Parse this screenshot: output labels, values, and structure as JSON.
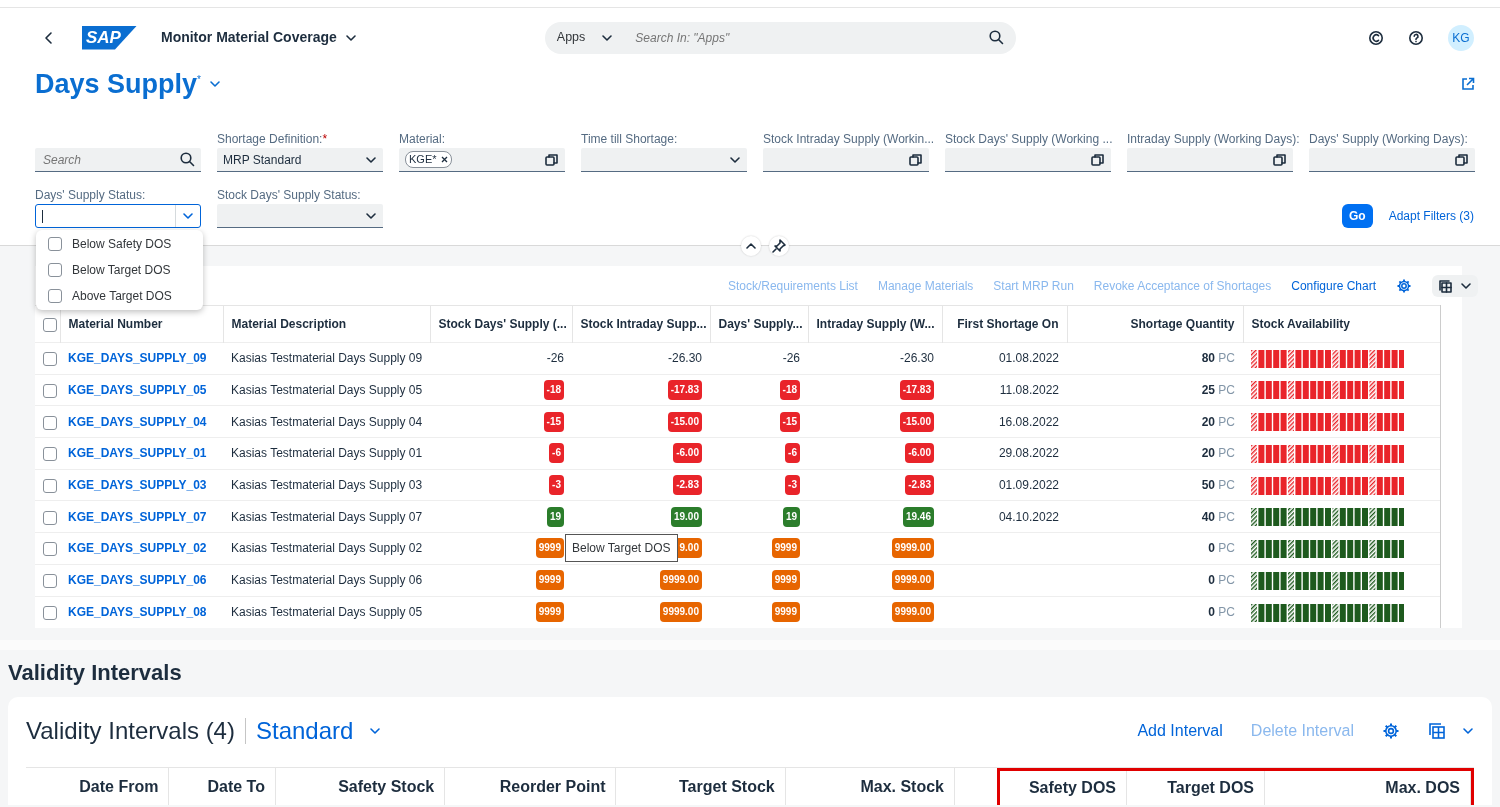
{
  "shell": {
    "logo": "SAP",
    "app_title": "Monitor Material Coverage",
    "search_scope": "Apps",
    "search_placeholder": "Search In: \"Apps\"",
    "avatar": "KG"
  },
  "page": {
    "title": "Days Supply",
    "modified_mark": "*"
  },
  "filter_rows": [
    [
      {
        "kind": "search",
        "placeholder": "Search"
      },
      {
        "kind": "select",
        "label": "Shortage Definition:",
        "required": true,
        "value": "MRP Standard"
      },
      {
        "kind": "valuehelp",
        "label": "Material:",
        "tokens": [
          "KGE*"
        ]
      },
      {
        "kind": "select",
        "label": "Time till Shortage:"
      },
      {
        "kind": "valuehelp",
        "label": "Stock Intraday Supply (Workin..."
      },
      {
        "kind": "valuehelp",
        "label": "Stock Days' Supply (Working ..."
      },
      {
        "kind": "valuehelp",
        "label": "Intraday Supply (Working Days):"
      },
      {
        "kind": "valuehelp",
        "label": "Days' Supply (Working Days):"
      }
    ],
    [
      {
        "kind": "combo",
        "label": "Days' Supply Status:",
        "focused": true,
        "expanded": true,
        "options": [
          {
            "label": "Below Safety DOS",
            "checked": false
          },
          {
            "label": "Below Target DOS",
            "checked": false
          },
          {
            "label": "Above Target DOS",
            "checked": false
          }
        ]
      },
      {
        "kind": "select",
        "label": "Stock Days' Supply Status:"
      }
    ]
  ],
  "filter_actions": {
    "go": "Go",
    "adapt": "Adapt Filters (3)"
  },
  "table": {
    "toolbar": [
      {
        "label": "Stock/Requirements List",
        "disabled": true
      },
      {
        "label": "Manage Materials",
        "disabled": true
      },
      {
        "label": "Start MRP Run",
        "disabled": true
      },
      {
        "label": "Revoke Acceptance of Shortages",
        "disabled": true
      },
      {
        "label": "Configure Chart",
        "disabled": false
      }
    ],
    "select_all": false,
    "columns": [
      {
        "label": "Material Number"
      },
      {
        "label": "Material Description"
      },
      {
        "label": "Stock Days' Supply (..."
      },
      {
        "label": "Stock Intraday Supp..."
      },
      {
        "label": "Days' Supply..."
      },
      {
        "label": "Intraday Supply (W..."
      },
      {
        "label": "First Shortage On"
      },
      {
        "label": "Shortage Quantity"
      },
      {
        "label": "Stock Availability"
      }
    ],
    "rows": [
      {
        "selected": false,
        "material": "KGE_DAYS_SUPPLY_09",
        "description": "Kasias Testmaterial Days Supply 09",
        "values": [
          {
            "text": "-26"
          },
          {
            "text": "-26.30"
          },
          {
            "text": "-26"
          },
          {
            "text": "-26.30"
          }
        ],
        "first_shortage": "01.08.2022",
        "quantity": "80",
        "unit": "PC",
        "availability": {
          "color": "#e9242a"
        }
      },
      {
        "selected": false,
        "material": "KGE_DAYS_SUPPLY_05",
        "description": "Kasias Testmaterial Days Supply 05",
        "values": [
          {
            "text": "-18",
            "color": "#e9242a"
          },
          {
            "text": "-17.83",
            "color": "#e9242a"
          },
          {
            "text": "-18",
            "color": "#e9242a"
          },
          {
            "text": "-17.83",
            "color": "#e9242a"
          }
        ],
        "first_shortage": "11.08.2022",
        "quantity": "25",
        "unit": "PC",
        "availability": {
          "color": "#e9242a"
        }
      },
      {
        "selected": false,
        "material": "KGE_DAYS_SUPPLY_04",
        "description": "Kasias Testmaterial Days Supply 04",
        "values": [
          {
            "text": "-15",
            "color": "#e9242a"
          },
          {
            "text": "-15.00",
            "color": "#e9242a"
          },
          {
            "text": "-15",
            "color": "#e9242a"
          },
          {
            "text": "-15.00",
            "color": "#e9242a"
          }
        ],
        "first_shortage": "16.08.2022",
        "quantity": "20",
        "unit": "PC",
        "availability": {
          "color": "#e9242a"
        }
      },
      {
        "selected": false,
        "material": "KGE_DAYS_SUPPLY_01",
        "description": "Kasias Testmaterial Days Supply 01",
        "values": [
          {
            "text": "-6",
            "color": "#e9242a"
          },
          {
            "text": "-6.00",
            "color": "#e9242a"
          },
          {
            "text": "-6",
            "color": "#e9242a"
          },
          {
            "text": "-6.00",
            "color": "#e9242a"
          }
        ],
        "first_shortage": "29.08.2022",
        "quantity": "20",
        "unit": "PC",
        "availability": {
          "color": "#e9242a"
        }
      },
      {
        "selected": false,
        "material": "KGE_DAYS_SUPPLY_03",
        "description": "Kasias Testmaterial Days Supply 03",
        "values": [
          {
            "text": "-3",
            "color": "#e9242a"
          },
          {
            "text": "-2.83",
            "color": "#e9242a"
          },
          {
            "text": "-3",
            "color": "#e9242a"
          },
          {
            "text": "-2.83",
            "color": "#e9242a"
          }
        ],
        "first_shortage": "01.09.2022",
        "quantity": "50",
        "unit": "PC",
        "availability": {
          "color": "#e9242a"
        }
      },
      {
        "selected": false,
        "material": "KGE_DAYS_SUPPLY_07",
        "description": "Kasias Testmaterial Days Supply 07",
        "values": [
          {
            "text": "19",
            "color": "#2b7d2b"
          },
          {
            "text": "19.00",
            "color": "#2b7d2b"
          },
          {
            "text": "19",
            "color": "#2b7d2b"
          },
          {
            "text": "19.46",
            "color": "#2b7d2b"
          }
        ],
        "first_shortage": "04.10.2022",
        "quantity": "40",
        "unit": "PC",
        "availability": {
          "color": "#1e5a1e"
        }
      },
      {
        "selected": false,
        "material": "KGE_DAYS_SUPPLY_02",
        "description": "Kasias Testmaterial Days Supply 02",
        "values": [
          {
            "text": "9999",
            "color": "#e76500"
          },
          {
            "text": "9.00",
            "color": "#e76500"
          },
          {
            "text": "9999",
            "color": "#e76500"
          },
          {
            "text": "9999.00",
            "color": "#e76500"
          }
        ],
        "quantity": "0",
        "unit": "PC",
        "availability": {
          "color": "#1e5a1e"
        },
        "tooltip": "Below Target DOS"
      },
      {
        "selected": false,
        "material": "KGE_DAYS_SUPPLY_06",
        "description": "Kasias Testmaterial Days Supply 06",
        "values": [
          {
            "text": "9999",
            "color": "#e76500"
          },
          {
            "text": "9999.00",
            "color": "#e76500"
          },
          {
            "text": "9999",
            "color": "#e76500"
          },
          {
            "text": "9999.00",
            "color": "#e76500"
          }
        ],
        "quantity": "0",
        "unit": "PC",
        "availability": {
          "color": "#1e5a1e"
        }
      },
      {
        "selected": false,
        "material": "KGE_DAYS_SUPPLY_08",
        "description": "Kasias Testmaterial Days Supply 05",
        "values": [
          {
            "text": "9999",
            "color": "#e76500"
          },
          {
            "text": "9999.00",
            "color": "#e76500"
          },
          {
            "text": "9999",
            "color": "#e76500"
          },
          {
            "text": "9999.00",
            "color": "#e76500"
          }
        ],
        "quantity": "0",
        "unit": "PC",
        "availability": {
          "color": "#1e5a1e"
        }
      }
    ]
  },
  "validity": {
    "heading": "Validity Intervals",
    "title": "Validity Intervals (4)",
    "variant": "Standard",
    "actions": [
      {
        "label": "Add Interval",
        "disabled": false
      },
      {
        "label": "Delete Interval",
        "disabled": true
      }
    ],
    "columns": [
      {
        "label": "Date From",
        "highlighted": false
      },
      {
        "label": "Date To",
        "highlighted": false
      },
      {
        "label": "Safety Stock",
        "highlighted": false
      },
      {
        "label": "Reorder Point",
        "highlighted": false
      },
      {
        "label": "Target Stock",
        "highlighted": false
      },
      {
        "label": "Max. Stock",
        "highlighted": false
      },
      {
        "label": "Safety DOS",
        "highlighted": true
      },
      {
        "label": "Target DOS",
        "highlighted": true
      },
      {
        "label": "Max. DOS",
        "highlighted": true
      }
    ]
  }
}
